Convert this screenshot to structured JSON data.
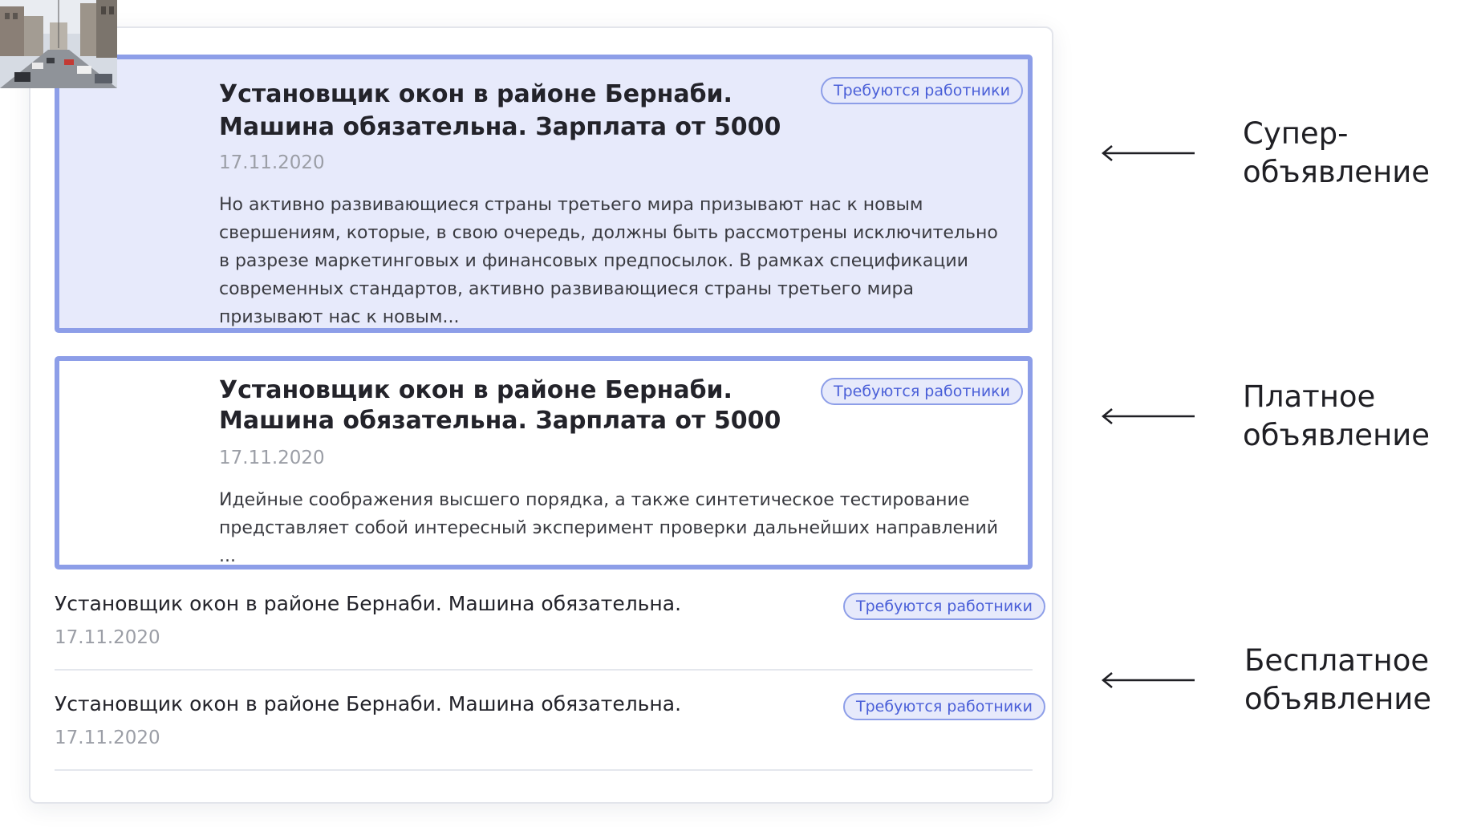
{
  "listings": {
    "super": {
      "title": "Установщик окон в районе Бернаби. Машина обязательна. Зарплата от 5000",
      "date": "17.11.2020",
      "badge": "Требуются работники",
      "description": "Но активно развивающиеся страны третьего мира призывают нас к новым свершениям, которые, в свою очередь, должны быть рассмотрены исключительно в разрезе маркетинговых и финансовых предпосылок. В рамках спецификации современных стандартов, активно развивающиеся страны третьего мира призывают нас к новым...",
      "thumbnail_icon": "street-photo"
    },
    "paid": {
      "title": "Установщик окон в районе Бернаби. Машина обязательна. Зарплата от 5000",
      "date": "17.11.2020",
      "badge": "Требуются работники",
      "description": "Идейные соображения высшего порядка, а также синтетическое тестирование представляет собой интересный эксперимент проверки дальнейших направлений ...",
      "thumbnail_icon": "street-photo"
    },
    "free": [
      {
        "title": "Установщик окон в районе Бернаби. Машина обязательна.",
        "date": "17.11.2020",
        "badge": "Требуются работники"
      },
      {
        "title": "Установщик окон в районе Бернаби. Машина обязательна.",
        "date": "17.11.2020",
        "badge": "Требуются работники"
      }
    ]
  },
  "legend": {
    "super": "Супер-\nобъявление",
    "paid": "Платное\nобъявление",
    "free": "Бесплатное\nобъявление",
    "arrow_icon": "arrow-left-icon"
  },
  "colors": {
    "accent_border": "#8d9ee8",
    "super_background": "#e7eafb",
    "badge_text": "#4a5fd8",
    "date_text": "#9b9ea6"
  }
}
